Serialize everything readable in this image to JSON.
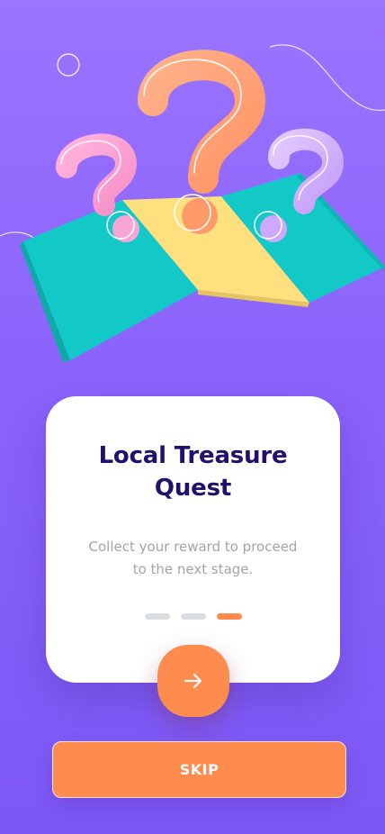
{
  "onboarding": {
    "title": "Local Treasure Quest",
    "description": "Collect your reward to proceed to the next stage.",
    "pagination": {
      "total": 3,
      "current": 3
    },
    "next_icon": "arrow-right-icon",
    "skip_label": "SKIP"
  },
  "colors": {
    "background_top": "#9b74ff",
    "background_bottom": "#7c58f6",
    "accent": "#ff8c4f",
    "title": "#21106e",
    "body_text": "#a3a3ad",
    "inactive_dot": "#dcdde3"
  },
  "illustration": {
    "icon": "question-marks-map-illustration"
  }
}
